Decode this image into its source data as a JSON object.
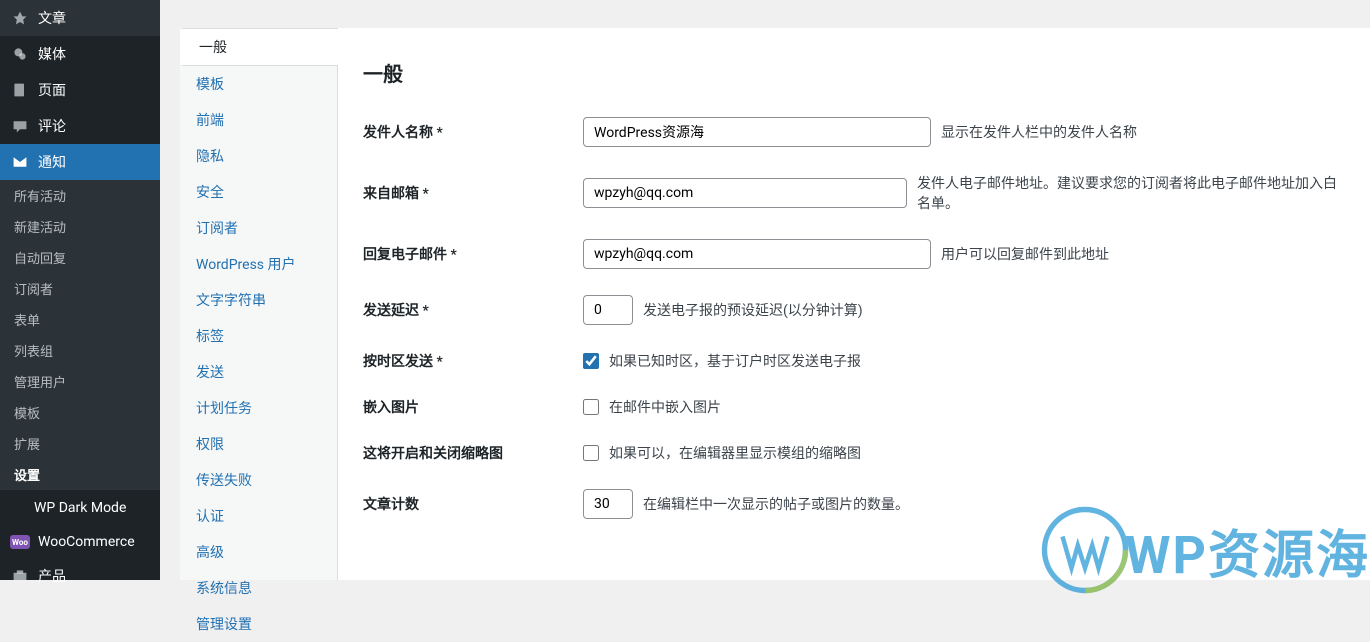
{
  "mainNav": {
    "posts": "文章",
    "media": "媒体",
    "pages": "页面",
    "comments": "评论",
    "notifications": "通知"
  },
  "subNav": {
    "items": [
      "所有活动",
      "新建活动",
      "自动回复",
      "订阅者",
      "表单",
      "列表组",
      "管理用户",
      "模板",
      "扩展",
      "设置"
    ]
  },
  "mainNavBottom": {
    "darkMode": "WP Dark Mode",
    "woo": "WooCommerce",
    "products": "产品"
  },
  "tabs": {
    "items": [
      "一般",
      "模板",
      "前端",
      "隐私",
      "安全",
      "订阅者",
      "WordPress 用户",
      "文字字符串",
      "标签",
      "发送",
      "计划任务",
      "权限",
      "传送失败",
      "认证",
      "高级",
      "系统信息",
      "管理设置"
    ]
  },
  "page": {
    "title": "一般"
  },
  "form": {
    "senderName": {
      "label": "发件人名称 *",
      "value": "WordPress资源海",
      "desc": "显示在发件人栏中的发件人名称"
    },
    "fromEmail": {
      "label": "来自邮箱 *",
      "value": "wpzyh@qq.com",
      "desc": "发件人电子邮件地址。建议要求您的订阅者将此电子邮件地址加入白名单。"
    },
    "replyEmail": {
      "label": "回复电子邮件 *",
      "value": "wpzyh@qq.com",
      "desc": "用户可以回复邮件到此地址"
    },
    "sendDelay": {
      "label": "发送延迟 *",
      "value": "0",
      "desc": "发送电子报的预设延迟(以分钟计算)"
    },
    "timezone": {
      "label": "按时区发送 *",
      "desc": "如果已知时区，基于订户时区发送电子报"
    },
    "embedImages": {
      "label": "嵌入图片",
      "desc": "在邮件中嵌入图片"
    },
    "thumbnails": {
      "label": "这将开启和关闭缩略图",
      "desc": "如果可以，在编辑器里显示模组的缩略图"
    },
    "postCount": {
      "label": "文章计数",
      "value": "30",
      "desc": "在编辑栏中一次显示的帖子或图片的数量。"
    }
  },
  "watermark": {
    "text": "WP资源海"
  }
}
